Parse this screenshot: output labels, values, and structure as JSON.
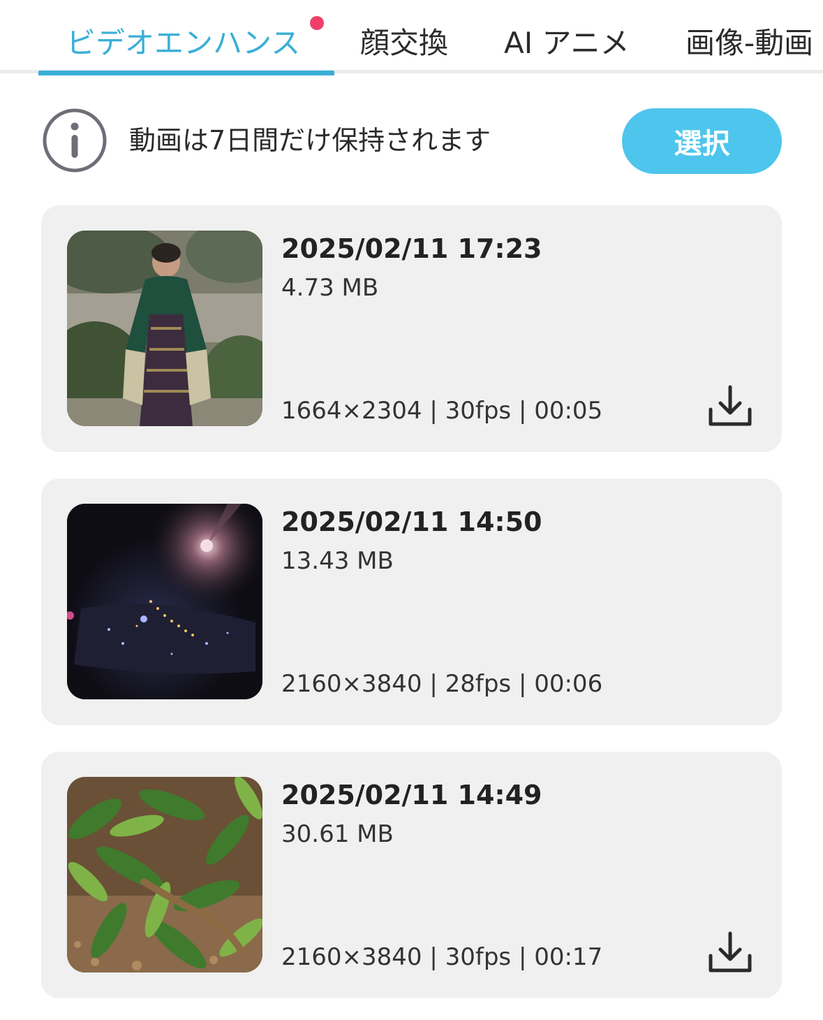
{
  "tabs": [
    {
      "label": "ビデオエンハンス",
      "active": true
    },
    {
      "label": "顔交換",
      "active": false
    },
    {
      "label": "AI アニメ",
      "active": false
    },
    {
      "label": "画像-動画",
      "active": false
    }
  ],
  "info": {
    "icon": "info-icon",
    "text": "動画は7日間だけ保持されます",
    "select_label": "選択"
  },
  "colors": {
    "accent": "#3aafd6",
    "button": "#4ec5ec",
    "notification": "#ef3e6a",
    "card_bg": "#f0f0f0"
  },
  "videos": [
    {
      "date": "2025/02/11 17:23",
      "size": "4.73 MB",
      "meta": "1664×2304 | 30fps | 00:05",
      "thumbnail": "child-in-kimono-photo",
      "download_icon": "download-icon"
    },
    {
      "date": "2025/02/11 14:50",
      "size": "13.43 MB",
      "meta": "2160×3840 | 28fps | 00:06",
      "thumbnail": "night-city-lights-photo",
      "download_icon": null
    },
    {
      "date": "2025/02/11 14:49",
      "size": "30.61 MB",
      "meta": "2160×3840 | 30fps | 00:17",
      "thumbnail": "lizard-in-leaves-photo",
      "download_icon": "download-icon"
    }
  ]
}
